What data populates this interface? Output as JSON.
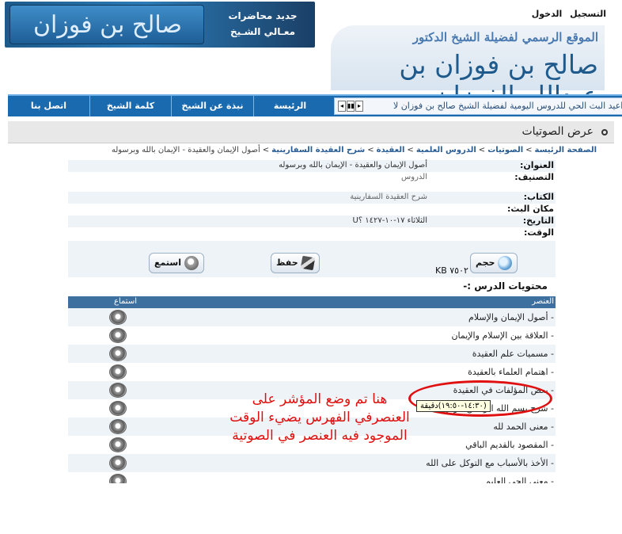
{
  "header": {
    "banner_logo_text": "صالح بن فوزان الفوزان",
    "banner_news_line1": "جديد محاضرات",
    "banner_news_line2": "معـالي الشـيخ",
    "user_links": {
      "register": "التسجيل",
      "login": "الدخول"
    },
    "site_subtitle": "الموقع الرسمي لفضيلة الشيخ الدكتور",
    "site_title": "صالح بن فوزان بن عبدالله الفوزان"
  },
  "nav": {
    "items": [
      {
        "label": "الرئيسة"
      },
      {
        "label": "نبذة عن الشيخ"
      },
      {
        "label": "كلمة الشيخ"
      },
      {
        "label": "اتصل بنا"
      }
    ],
    "ticker_text": "كم مواعيد البث الحي للدروس اليومية لفضيلة الشيخ صالح بن فوزان   لا",
    "ticker_controls": [
      "◂",
      "▮▮",
      "▸"
    ]
  },
  "page": {
    "title": "عرض الصوتيات",
    "breadcrumb": [
      "الصفحة الرئيسة",
      "الصوتيات",
      "الدروس العلمية",
      "العقيدة",
      "شرح العقيدة السفارينية",
      "أصول الإيمان والعقيدة - الإيمان بالله وبرسوله"
    ],
    "breadcrumb_separator": ">",
    "details": [
      {
        "label": "العنوان:",
        "value": "أصول الإيمان والعقيدة - الإيمان بالله وبرسوله"
      },
      {
        "label": "التصنيف:",
        "value": "الدروس"
      },
      {
        "label": "الكتاب:",
        "value": "شرح العقيدة السفارينية"
      },
      {
        "label": "مكان البث:",
        "value": ""
      },
      {
        "label": "التاريخ:",
        "value": "الثلاثاء ١٧-١٠-١٤٢٧ ؟U"
      },
      {
        "label": "الوقت:",
        "value": ""
      }
    ],
    "actions": {
      "size_label": "حجم",
      "size_value": "٧٥٠٢ KB",
      "save_label": "حفظ",
      "listen_label": "استمع"
    },
    "contents_title": "محتويات الدرس :-",
    "table": {
      "col_item": "العنصر",
      "col_listen": "استماع",
      "rows": [
        "- أصول الإيمان والإسلام",
        "- العلاقة بين الإسلام والإيمان",
        "- مسميات علم العقيدة",
        "- اهتمام العلماء بالعقيدة",
        "- بعض المؤلفات في العقيدة",
        "- شرح بسم الله الرحمن الرحيم",
        "- معنى الحمد لله",
        "- المقصود بالقديم الباقي",
        "- الأخذ بالأسباب مع التوكل على الله",
        "- معنى الحي العليم"
      ]
    },
    "tooltip": "(١٤:٣٠-١٩:٥٠)دقيقة",
    "annotation": "هنا تم وضع المؤشر على العنصرفي الفهرس يضيء الوقت الموجود فيه العنصر في الصوتية"
  }
}
